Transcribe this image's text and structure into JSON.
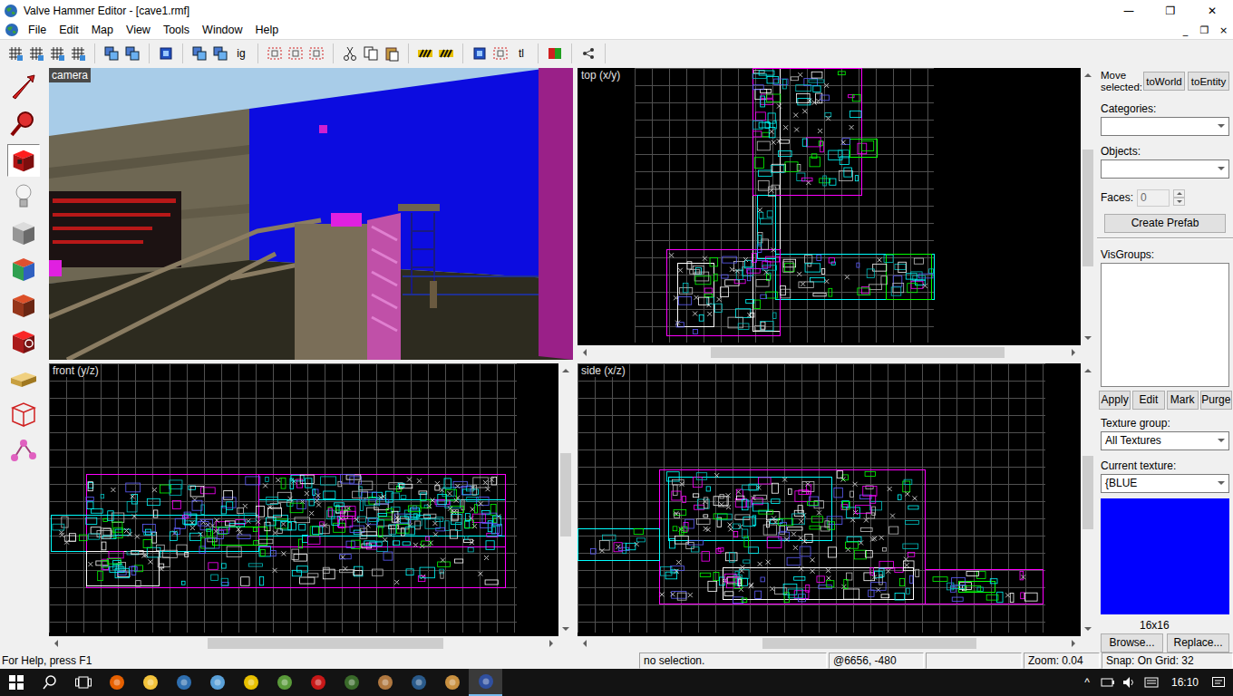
{
  "window": {
    "title": "Valve Hammer Editor - [cave1.rmf]",
    "controls": [
      "—",
      "❐",
      "✕"
    ]
  },
  "menu": {
    "items": [
      "File",
      "Edit",
      "Map",
      "View",
      "Tools",
      "Window",
      "Help"
    ],
    "mdi_controls": [
      "_",
      "❐",
      "×"
    ]
  },
  "toolbar": {
    "glyphs": [
      "ig",
      "tl"
    ]
  },
  "tools": [
    {
      "selected": false
    },
    {
      "selected": false
    },
    {
      "selected": true
    },
    {
      "selected": false
    },
    {
      "selected": false
    },
    {
      "selected": false
    },
    {
      "selected": false
    },
    {
      "selected": false
    },
    {
      "selected": false
    },
    {
      "selected": false
    },
    {
      "selected": false
    }
  ],
  "viewports": [
    {
      "label": "camera",
      "kind": "camera"
    },
    {
      "label": "top (x/y)",
      "kind": "grid",
      "h_scroll": {
        "start": 0.25,
        "size": 0.62
      },
      "v_scroll": {
        "start": 0.27,
        "size": 0.47
      }
    },
    {
      "label": "front (y/z)",
      "kind": "grid",
      "h_scroll": {
        "start": 0.3,
        "size": 0.49
      },
      "v_scroll": {
        "start": 0.31,
        "size": 0.34
      }
    },
    {
      "label": "side (x/z)",
      "kind": "grid",
      "h_scroll": {
        "start": 0.36,
        "size": 0.45
      },
      "v_scroll": {
        "start": 0.32,
        "size": 0.3
      }
    }
  ],
  "panel": {
    "move_label": "Move selected:",
    "move_buttons": [
      "toWorld",
      "toEntity"
    ],
    "categories_label": "Categories:",
    "objects_label": "Objects:",
    "faces": {
      "label": "Faces:",
      "value": "0",
      "disabled": true
    },
    "create_prefab": "Create Prefab",
    "visgroups_label": "VisGroups:",
    "visgroup_buttons": [
      "Apply",
      "Edit",
      "Mark",
      "Purge"
    ],
    "texture_group": {
      "label": "Texture group:",
      "value": "All Textures"
    },
    "current_texture": {
      "label": "Current texture:",
      "value": "{BLUE",
      "size": "16x16"
    },
    "texture_buttons": [
      "Browse...",
      "Replace..."
    ]
  },
  "status_bar": {
    "help": "For Help, press F1",
    "selection": "no selection.",
    "coords": "@6656, -480",
    "zoom": "Zoom: 0.04",
    "snap": "Snap: On Grid: 32"
  },
  "taskbar": {
    "apps": [
      {
        "active": false
      },
      {
        "active": false
      },
      {
        "active": false
      },
      {
        "active": false
      },
      {
        "active": false
      },
      {
        "active": false
      },
      {
        "active": false
      },
      {
        "active": false
      },
      {
        "active": false
      },
      {
        "active": false
      },
      {
        "active": false
      },
      {
        "active": true
      }
    ],
    "tray_glyph": "^",
    "time": "16:10"
  }
}
